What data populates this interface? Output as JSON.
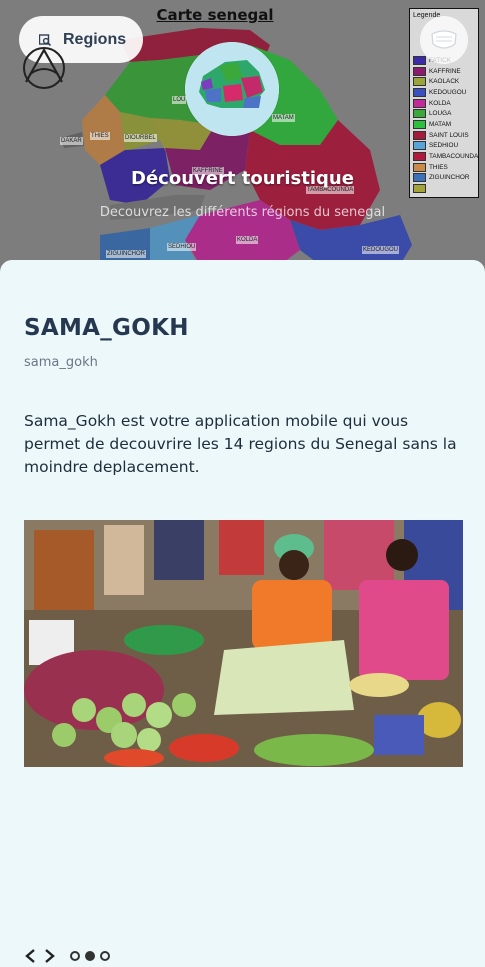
{
  "map": {
    "title": "Carte senegal",
    "legend_title": "Legende",
    "legend": [
      {
        "name": "FATICK",
        "color": "#3b2aa8"
      },
      {
        "name": "KAFFRINE",
        "color": "#8b1b6e"
      },
      {
        "name": "KAOLACK",
        "color": "#9aa43a"
      },
      {
        "name": "KEDOUGOU",
        "color": "#3a4fc0"
      },
      {
        "name": "KOLDA",
        "color": "#c22a9a"
      },
      {
        "name": "LOUGA",
        "color": "#3aa83a"
      },
      {
        "name": "MATAM",
        "color": "#2fbf3f"
      },
      {
        "name": "SAINT LOUIS",
        "color": "#a31c3c"
      },
      {
        "name": "SEDHIOU",
        "color": "#58a4d6"
      },
      {
        "name": "TAMBACOUNDA",
        "color": "#b3193f"
      },
      {
        "name": "THIES",
        "color": "#c98a4a"
      },
      {
        "name": "ZIGUINCHOR",
        "color": "#3b71b8"
      },
      {
        "name": "",
        "color": "#a3a33a"
      }
    ],
    "region_labels": {
      "louga": "LOU",
      "matam": "MATAM",
      "dakar": "DAKAR",
      "thies": "THIES",
      "diourbel": "DIOURBEL",
      "kaffrine": "KAFFRINE",
      "tambacounda": "TAMBACOUNDA",
      "ziguinchor": "ZIGUINCHOR",
      "sedhiou": "SEDHIOU",
      "kolda": "KOLDA",
      "kedougou": "KEDOUGOU"
    }
  },
  "header": {
    "regions_button": "Regions",
    "hero_title": "Découvert touristique",
    "hero_subtitle": "Decouvrez les différents régions du senegal"
  },
  "app": {
    "name": "SAMA_GOKH",
    "handle": "sama_gokh",
    "description": "Sama_Gokh est votre application mobile qui vous permet de decouvrire les 14 regions du Senegal sans la moindre deplacement."
  },
  "pager": {
    "dots": 3,
    "active_index": 1
  },
  "icons": {
    "regions": "map-search-icon",
    "logo": "tent-logo-icon",
    "mask": "face-mask-icon",
    "prev": "chevron-left-icon",
    "next": "chevron-right-icon"
  }
}
